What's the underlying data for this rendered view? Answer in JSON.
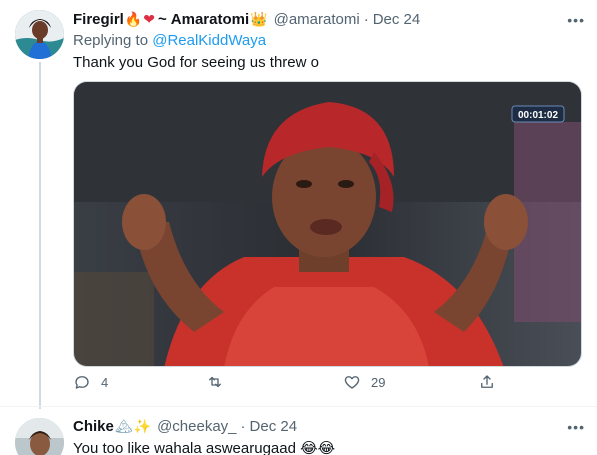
{
  "tweet_main": {
    "display_name_part1": "Firegirl",
    "display_name_part2": "Amaratomi",
    "emojis_before": [
      "fire-emoji",
      "red-heart-emoji"
    ],
    "emoji_after": "crown-emoji",
    "handle": "@amaratomi",
    "date": "Dec 24",
    "replying_label": "Replying to ",
    "replying_to": "@RealKiddWaya",
    "text": "Thank you God for seeing us threw o",
    "video_timer": "00:01:02",
    "reply_count": "4",
    "retweet_count": "",
    "like_count": "29"
  },
  "tweet_reply": {
    "display_name": "Chike",
    "emojis": [
      "mountain-emoji",
      "sparkles-emoji"
    ],
    "handle": "@cheekay_",
    "date": "Dec 24",
    "text": "You too like wahala aswearugaad 😂😂"
  },
  "colors": {
    "link": "#1d9bf0",
    "secondary_text": "#536471",
    "primary_text": "#0f1419",
    "thread_line": "#cfd9de"
  }
}
